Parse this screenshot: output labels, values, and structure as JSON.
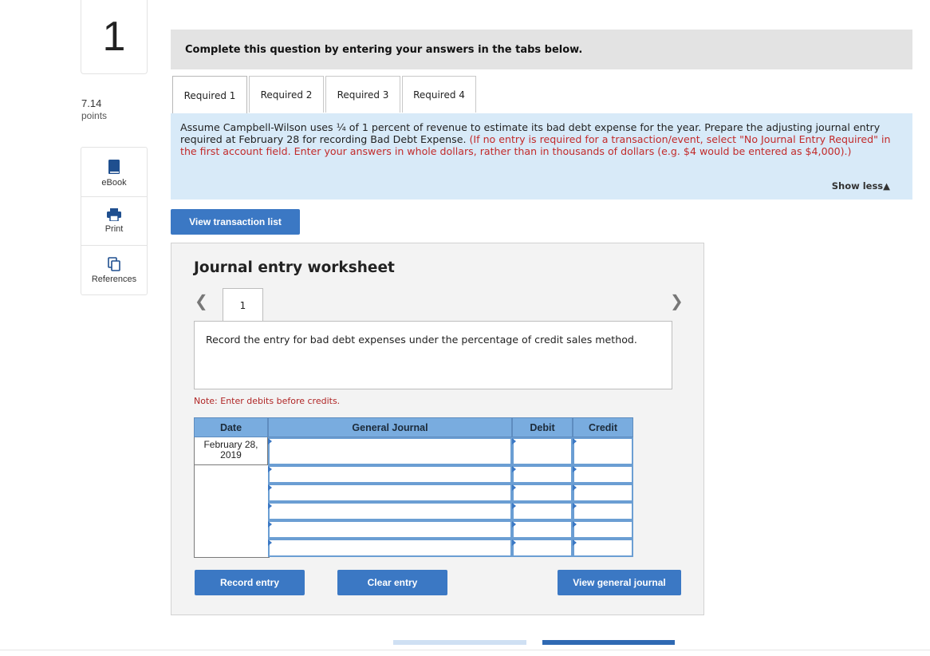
{
  "question": {
    "number": "1",
    "points_value": "7.14",
    "points_label": "points"
  },
  "side_tools": [
    {
      "label": "eBook",
      "icon": "book-icon"
    },
    {
      "label": "Print",
      "icon": "printer-icon"
    },
    {
      "label": "References",
      "icon": "copy-pages-icon"
    }
  ],
  "instructions": "Complete this question by entering your answers in the tabs below.",
  "tabs": [
    "Required 1",
    "Required 2",
    "Required 3",
    "Required 4"
  ],
  "active_tab": "Required 1",
  "prompt": {
    "text": "Assume Campbell-Wilson uses ¼ of 1 percent of revenue to estimate its bad debt expense for the year. Prepare the adjusting journal entry required at February 28 for recording Bad Debt Expense.",
    "hint": "(If no entry is required for a transaction/event, select \"No Journal Entry Required\" in the first account field. Enter your answers in whole dollars, rather than in thousands of dollars (e.g. $4 would be entered as $4,000).)",
    "show_less": "Show less▲"
  },
  "view_transaction_button": "View transaction list",
  "worksheet": {
    "title": "Journal entry worksheet",
    "prev_icon": "chevron-left-icon",
    "next_icon": "chevron-right-icon",
    "tab_label": "1",
    "description": "Record the entry for bad debt expenses under the percentage of credit sales method.",
    "note": "Note: Enter debits before credits.",
    "columns": [
      "Date",
      "General Journal",
      "Debit",
      "Credit"
    ],
    "rows": [
      {
        "date": "February 28, 2019",
        "account": "",
        "debit": "",
        "credit": ""
      },
      {
        "date": "",
        "account": "",
        "debit": "",
        "credit": ""
      },
      {
        "date": "",
        "account": "",
        "debit": "",
        "credit": ""
      },
      {
        "date": "",
        "account": "",
        "debit": "",
        "credit": ""
      },
      {
        "date": "",
        "account": "",
        "debit": "",
        "credit": ""
      },
      {
        "date": "",
        "account": "",
        "debit": "",
        "credit": ""
      }
    ],
    "buttons": {
      "record": "Record entry",
      "clear": "Clear entry",
      "view_journal": "View general journal"
    }
  },
  "colors": {
    "button_blue": "#3b78c4",
    "panel_blue": "#d8eaf8",
    "table_header_blue": "#79acdf",
    "hint_red": "#c22a2a"
  }
}
